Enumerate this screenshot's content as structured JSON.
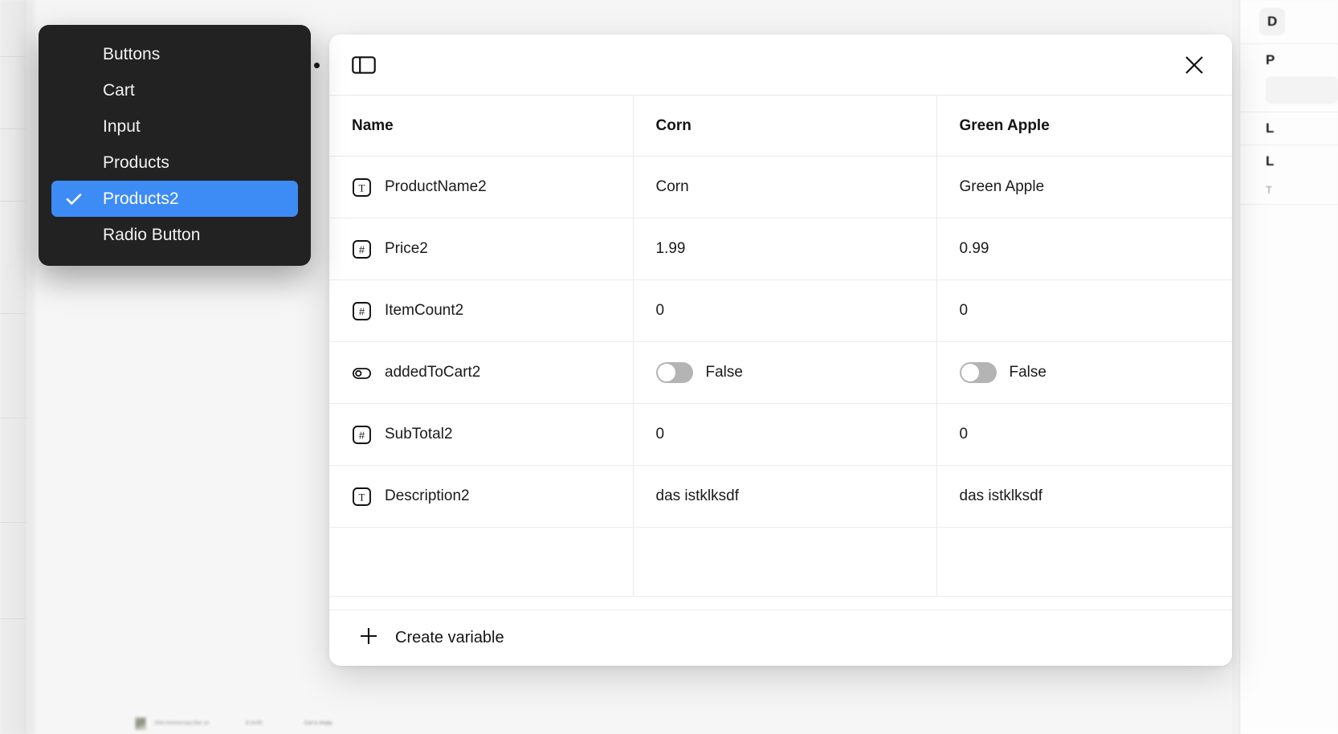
{
  "context_menu": {
    "items": [
      {
        "label": "Buttons",
        "selected": false
      },
      {
        "label": "Cart",
        "selected": false
      },
      {
        "label": "Input",
        "selected": false
      },
      {
        "label": "Products",
        "selected": false
      },
      {
        "label": "Products2",
        "selected": true
      },
      {
        "label": "Radio Button",
        "selected": false
      }
    ],
    "selected_color": "#3d8bf5",
    "background_color": "#222222"
  },
  "modal": {
    "header": {
      "panel_toggle_icon": "panel-layout-icon",
      "close_icon": "close-icon"
    },
    "table": {
      "columns": [
        "Name",
        "Corn",
        "Green Apple"
      ],
      "rows": [
        {
          "type_icon": "text-type-icon",
          "name": "ProductName2",
          "corn": "Corn",
          "green_apple": "Green Apple"
        },
        {
          "type_icon": "number-type-icon",
          "name": "Price2",
          "corn": "1.99",
          "green_apple": "0.99"
        },
        {
          "type_icon": "number-type-icon",
          "name": "ItemCount2",
          "corn": "0",
          "green_apple": "0"
        },
        {
          "type_icon": "boolean-type-icon",
          "name": "addedToCart2",
          "corn": "False",
          "green_apple": "False",
          "boolean": true,
          "corn_on": false,
          "green_apple_on": false
        },
        {
          "type_icon": "number-type-icon",
          "name": "SubTotal2",
          "corn": "0",
          "green_apple": "0"
        },
        {
          "type_icon": "text-type-icon",
          "name": "Description2",
          "corn": "das istklksdf",
          "green_apple": "das istklksdf"
        }
      ]
    },
    "footer": {
      "create_label": "Create variable",
      "plus_icon": "plus-icon"
    }
  },
  "background": {
    "product_strip": {
      "title": "20th Anniversary Bar oil",
      "price": "$ 14.99",
      "cart_status": "Cart is empty"
    },
    "right_panel": {
      "line1": "D",
      "line2": "P",
      "line3": "L",
      "line4": "L",
      "line5": "T"
    }
  }
}
